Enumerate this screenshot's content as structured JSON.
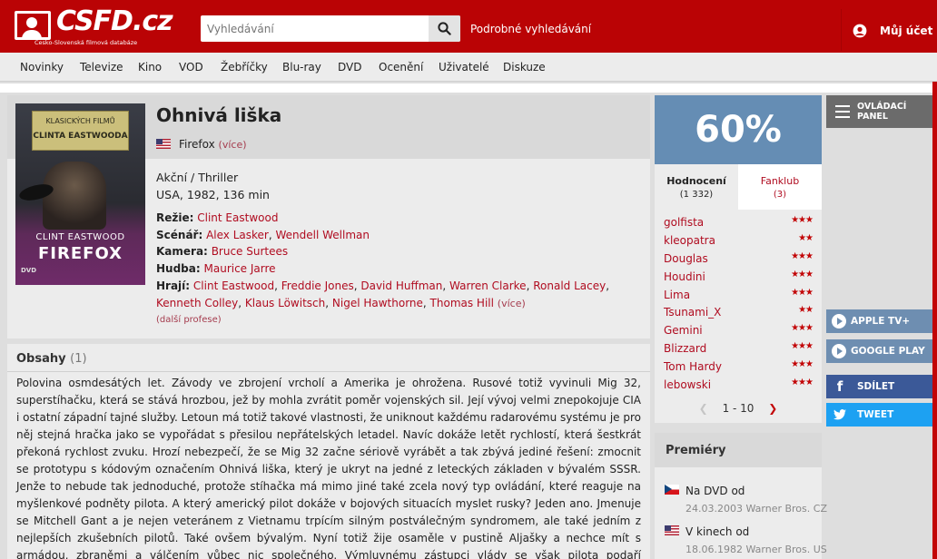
{
  "header": {
    "logo_text": "CSFD.cz",
    "logo_tagline": "Česko-Slovenská filmová databáze",
    "search_placeholder": "Vyhledávání",
    "advanced_search": "Podrobné vyhledávání",
    "account": "Můj účet",
    "colors": {
      "brand": "#ba0305",
      "rating": "#658db4"
    }
  },
  "nav": [
    "Novinky",
    "Televize",
    "Kino",
    "VOD",
    "Žebříčky",
    "Blu-ray",
    "DVD",
    "Ocenění",
    "Uživatelé",
    "Diskuze"
  ],
  "film": {
    "title": "Ohnivá liška",
    "alt_title": "Firefox",
    "alt_more": "(více)",
    "genre": "Akční / Thriller",
    "origin": "USA, 1982, 136 min",
    "poster": {
      "series": "KLASICKÝCH FILMŮ",
      "series_name": "CLINTA EASTWOODA",
      "actor": "CLINT EASTWOOD",
      "title": "FIREFOX",
      "dvd": "DVD"
    },
    "crew": {
      "director_label": "Režie:",
      "director": "Clint Eastwood",
      "writer_label": "Scénář:",
      "writer1": "Alex Lasker",
      "writer2": "Wendell Wellman",
      "camera_label": "Kamera:",
      "camera": "Bruce Surtees",
      "music_label": "Hudba:",
      "music": "Maurice Jarre",
      "cast_label": "Hrají:",
      "cast": [
        "Clint Eastwood",
        "Freddie Jones",
        "David Huffman",
        "Warren Clarke",
        "Ronald Lacey",
        "Kenneth Colley",
        "Klaus Löwitsch",
        "Nigel Hawthorne",
        "Thomas Hill"
      ],
      "cast_more": "(více)",
      "more_professions": "(další profese)"
    }
  },
  "plot": {
    "heading": "Obsahy",
    "count": "(1)",
    "text": "Polovina osmdesátých let. Závody ve zbrojení vrcholí a Amerika je ohrožena. Rusové totiž vyvinuli Mig 32, superstíhačku, která se stává hrozbou, jež by mohla zvrátit poměr vojenských sil. Její vývoj velmi znepokojuje CIA i ostatní západní tajné služby. Letoun má totiž takové vlastnosti, že uniknout každému radarovému systému je pro něj stejná hračka jako se vypořádat s přesilou nepřátelských letadel. Navíc dokáže letět rychlostí, která šestkrát překoná rychlost zvuku. Hrozí nebezpečí, že se Mig 32 začne sériově vyrábět a tak zbývá jediné řešení: zmocnit se prototypu s kódovým označením Ohnivá liška, který je ukryt na jedné z leteckých základen v bývalém SSSR. Jenže to nebude tak jednoduché, protože stíhačka má mimo jiné také zcela nový typ ovládání, které reaguje na myšlenkové podněty pilota. A který americký pilot dokáže v bojových situacích myslet rusky? Jeden ano. Jmenuje se Mitchell Gant a je nejen veteránem z Vietnamu trpícím silným postválečným syndromem, ale také jedním z nejlepších zkušebních pilotů. Také ovšem bývalým. Nyní totiž žije osaměle v pustině Aljašky a nechce mít s armádou, zbraněmi a válčením vůbec nic společného. Výmluvnému zástupci vlády se však pilota podaří přesvědčit, aby ještě jednou vyrazil na poslední,"
  },
  "rating": {
    "value": "60%",
    "tab_ratings": "Hodnocení",
    "tab_ratings_count": "(1 332)",
    "tab_fanclub": "Fanklub",
    "tab_fanclub_count": "(3)",
    "users": [
      {
        "name": "golfista",
        "stars": 3
      },
      {
        "name": "kleopatra",
        "stars": 2
      },
      {
        "name": "Douglas",
        "stars": 3
      },
      {
        "name": "Houdini",
        "stars": 3
      },
      {
        "name": "Lima",
        "stars": 3
      },
      {
        "name": "Tsunami_X",
        "stars": 2
      },
      {
        "name": "Gemini",
        "stars": 3
      },
      {
        "name": "Blizzard",
        "stars": 3
      },
      {
        "name": "Tom Hardy",
        "stars": 3
      },
      {
        "name": "lebowski",
        "stars": 3
      }
    ],
    "pager": "1 - 10"
  },
  "premieres": {
    "heading": "Premiéry",
    "items": [
      {
        "label": "Na DVD od",
        "date": "24.03.2003 Warner Bros. CZ",
        "flag": "cz"
      },
      {
        "label": "V kinech od",
        "date": "18.06.1982 Warner Bros. US",
        "flag": "us"
      }
    ]
  },
  "side": {
    "control_panel": "OVLÁDACÍ PANEL",
    "apple": "APPLE TV+",
    "google": "GOOGLE PLAY",
    "share": "SDÍLET",
    "tweet": "TWEET"
  }
}
